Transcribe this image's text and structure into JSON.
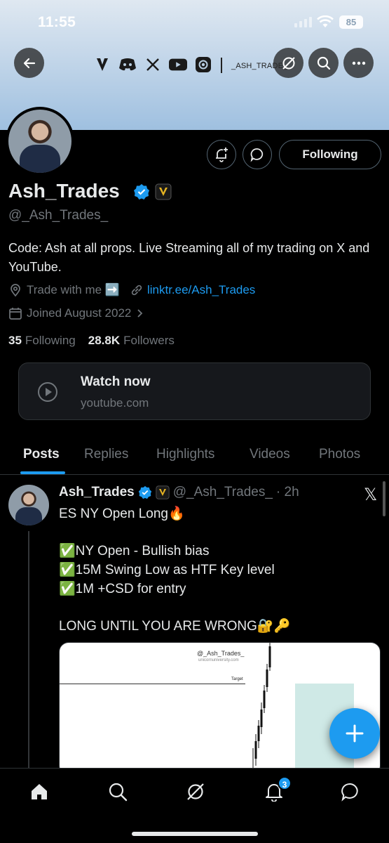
{
  "status_bar": {
    "time": "11:55",
    "battery": "85"
  },
  "banner": {
    "social_handle": "_ASH_TRADE_"
  },
  "profile": {
    "name": "Ash_Trades",
    "handle": "@_Ash_Trades_",
    "bio": "Code: Ash at all props. Live Streaming all of my trading on X and YouTube.",
    "location": "Trade with me ➡️",
    "link": "linktr.ee/Ash_Trades",
    "joined": "Joined August 2022",
    "following_count": "35",
    "following_label": "Following",
    "followers_count": "28.8K",
    "followers_label": "Followers",
    "follow_button": "Following"
  },
  "card": {
    "title": "Watch now",
    "subtitle": "youtube.com"
  },
  "tabs": [
    {
      "label": "Posts"
    },
    {
      "label": "Replies"
    },
    {
      "label": "Highlights"
    },
    {
      "label": "Videos"
    },
    {
      "label": "Photos"
    }
  ],
  "post": {
    "name": "Ash_Trades",
    "handle": "@_Ash_Trades_",
    "time": "· 2h",
    "lines": [
      "ES NY Open Long🔥",
      "✅NY Open - Bullish bias",
      "✅15M Swing Low as HTF Key level",
      "✅1M +CSD for entry",
      "LONG UNTIL YOU ARE WRONG🔐🔑"
    ],
    "media_watermark": "@_Ash_Trades_",
    "media_site": "unicornuniversity.com",
    "media_target": "Target"
  },
  "nav": {
    "notifications_badge": "3"
  },
  "colors": {
    "accent": "#1d9bf0",
    "background": "#000000",
    "muted": "#71767b"
  }
}
